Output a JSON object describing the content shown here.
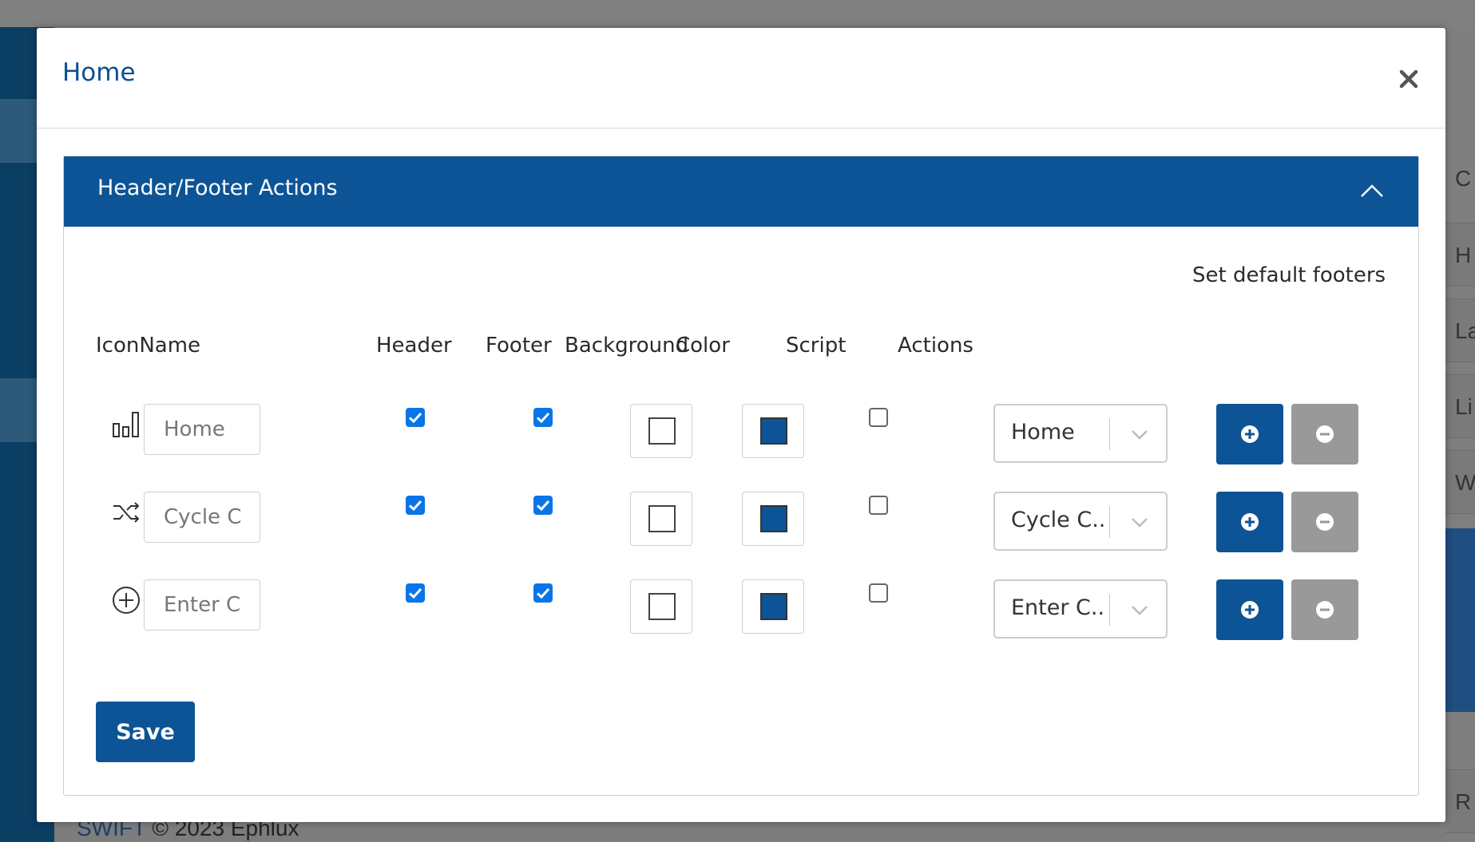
{
  "modal": {
    "title": "Home",
    "section_title": "Header/Footer Actions",
    "set_default_link": "Set default footers",
    "columns": {
      "icon_name": "IconName",
      "header": "Header",
      "footer": "Footer",
      "background": "Background",
      "color": "Color",
      "script": "Script",
      "actions": "Actions"
    },
    "rows": [
      {
        "icon": "bar-chart-icon",
        "name_placeholder": "Home",
        "header_checked": true,
        "footer_checked": true,
        "script_checked": false,
        "action_value": "Home"
      },
      {
        "icon": "shuffle-icon",
        "name_placeholder": "Cycle Count",
        "header_checked": true,
        "footer_checked": true,
        "script_checked": false,
        "action_value": "Cycle C..."
      },
      {
        "icon": "plus-circle-icon",
        "name_placeholder": "Enter Cycle",
        "header_checked": true,
        "footer_checked": true,
        "script_checked": false,
        "action_value": "Enter C..."
      }
    ],
    "save_label": "Save"
  },
  "background": {
    "footer_brand": "SWIFT",
    "footer_text": " © 2023 Ephlux",
    "right_strip_letters": [
      "H",
      "La",
      "Li",
      "W",
      "R"
    ],
    "right_top_letter": "C"
  },
  "colors": {
    "primary": "#0d5496",
    "title": "#0d4f93",
    "checkbox": "#0a75e6",
    "remove_button": "#999999"
  }
}
